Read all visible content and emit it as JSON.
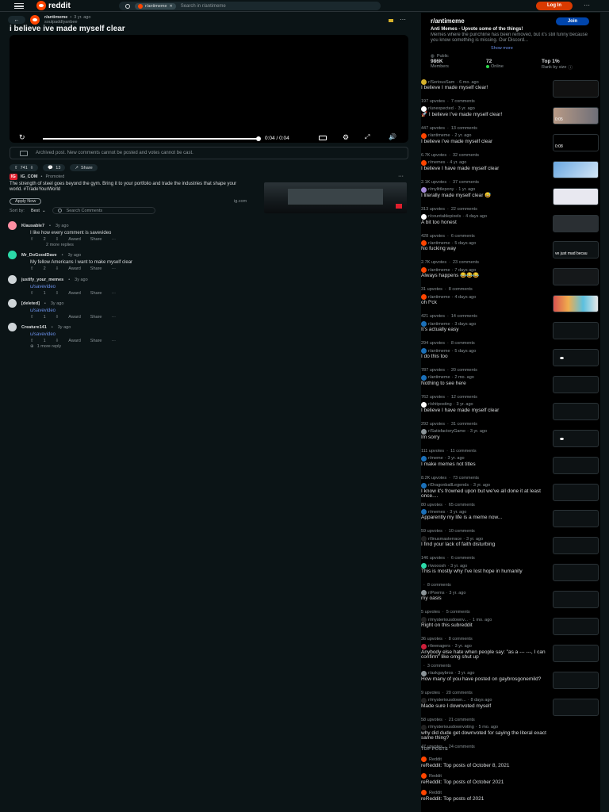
{
  "topbar": {
    "logo_text": "reddit",
    "search_chip": "r/antimeme",
    "search_placeholder": "Search in r/antimeme",
    "login_label": "Log In",
    "more_label": "···"
  },
  "post": {
    "subreddit": "r/antimeme",
    "time": "3 yr. ago",
    "author": "soulpaddlyanbee",
    "title": "i believe ive made myself clear",
    "video_time": "0:04 / 0:04",
    "progress": 1.0,
    "archived_notice": "Archived post. New comments cannot be posted and votes cannot be cast.",
    "votes": "741",
    "comments_count": "13",
    "share_label": "Share"
  },
  "ad": {
    "badge": "IG",
    "advertiser": "IG_COM",
    "promoted": "Promoted",
    "text": "The strength of steel goes beyond the gym. Bring it to your portfolio and trade the industries that shape your world. #TradeYourWorld",
    "cta": "Apply Now",
    "domain": "ig.com"
  },
  "sort": {
    "label": "Sort by:",
    "value": "Best",
    "search_placeholder": "Search Comments"
  },
  "comments": [
    {
      "author": "Klausable7",
      "time": "3y ago",
      "text": "I like how every comment is savevideo",
      "votes": "2",
      "award": "Award",
      "share": "Share",
      "extra": "2 more replies",
      "color": "#ff8fa3"
    },
    {
      "author": "Mr_DoGoodDave",
      "time": "3y ago",
      "text": "My fellow Americans I want to make myself clear",
      "votes": "2",
      "award": "Award",
      "share": "Share",
      "extra": "",
      "color": "#2bd9a8"
    },
    {
      "author": "justify_your_memes",
      "time": "3y ago",
      "text": "",
      "votes": "",
      "award": "",
      "share": "",
      "extra": "",
      "color": "#cfd5d8"
    },
    {
      "author": "u/savevideo",
      "time": "",
      "text": "",
      "votes": "1",
      "award": "Award",
      "share": "Share",
      "extra": "",
      "color": ""
    },
    {
      "author": "[deleted]",
      "time": "3y ago",
      "text": "u/savevideo",
      "votes": "1",
      "award": "Award",
      "share": "Share",
      "extra": "",
      "color": "#cfd5d8"
    },
    {
      "author": "Creature141",
      "time": "3y ago",
      "text": "u/savevideo",
      "votes": "1",
      "award": "Award",
      "share": "Share",
      "extra": "1 more reply",
      "color": "#cfd5d8"
    }
  ],
  "sidebar": {
    "name": "r/antimeme",
    "join_label": "Join",
    "desc_title": "Anti Memes - Upvote some of the things!",
    "desc": "Memes where the punchline has been removed, but it's still funny because you know something is missing. Our Discord...",
    "show_more": "Show more",
    "status": "Public",
    "members_value": "986K",
    "members_label": "Members",
    "online_value": "72",
    "online_label": "Online",
    "rank_value": "Top 1%",
    "rank_label": "Rank by size"
  },
  "related": [
    {
      "sub": "r/SeriousSam",
      "time": "6 mo. ago",
      "title": "I believe I made myself clear!",
      "upvotes": "197 upvotes",
      "comments": "7 comments",
      "icon_color": "#d6b12b",
      "thumb": "dark-figure",
      "thumb_text": ""
    },
    {
      "sub": "r/unexpected",
      "time": "3 yr. ago",
      "title": "🚀 I believe I've made myself clear!",
      "upvotes": "447 upvotes",
      "comments": "13 comments",
      "icon_color": "#ffffff",
      "thumb": "hand",
      "thumb_text": "0:05"
    },
    {
      "sub": "r/antimeme",
      "time": "2 yr. ago",
      "title": "I believe i've made myself clear",
      "upvotes": "6.7K upvotes",
      "comments": "32 comments",
      "icon_color": "#ff4500",
      "thumb": "black",
      "thumb_text": "0:08"
    },
    {
      "sub": "r/memes",
      "time": "4 yr. ago",
      "title": "I believe I have made myself clear",
      "upvotes": "2.1K upvotes",
      "comments": "37 comments",
      "icon_color": "#ff4500",
      "thumb": "blue",
      "thumb_text": ""
    },
    {
      "sub": "r/mylittlepony",
      "time": "1 yr. ago",
      "title": "I literally made myself clear 😅",
      "upvotes": "313 upvotes",
      "comments": "22 comments",
      "icon_color": "#a58ad9",
      "thumb": "white",
      "thumb_text": ""
    },
    {
      "sub": "r/countablepixels",
      "time": "4 days ago",
      "title": "A bit too honest",
      "upvotes": "428 upvotes",
      "comments": "6 comments",
      "icon_color": "#ffffff",
      "thumb": "grey",
      "thumb_text": ""
    },
    {
      "sub": "r/antimeme",
      "time": "5 days ago",
      "title": "No fucking way",
      "upvotes": "2.7K upvotes",
      "comments": "23 comments",
      "icon_color": "#ff4500",
      "thumb": "text",
      "thumb_text": "ve just mad becau"
    },
    {
      "sub": "r/antimeme",
      "time": "7 days ago",
      "title": "Always happens 😂😂😂",
      "upvotes": "31 upvotes",
      "comments": "8 comments",
      "icon_color": "#ff4500",
      "thumb": "dark",
      "thumb_text": ""
    },
    {
      "sub": "r/antimeme",
      "time": "4 days ago",
      "title": "oh f*ck",
      "upvotes": "421 upvotes",
      "comments": "14 comments",
      "icon_color": "#ff4500",
      "thumb": "colorful",
      "thumb_text": ""
    },
    {
      "sub": "r/antimeme",
      "time": "3 days ago",
      "title": "It's actually easy",
      "upvotes": "294 upvotes",
      "comments": "8 comments",
      "icon_color": "#1a6fb8",
      "thumb": "empty",
      "thumb_text": ""
    },
    {
      "sub": "r/antimeme",
      "time": "5 days ago",
      "title": "I do this too",
      "upvotes": "787 upvotes",
      "comments": "20 comments",
      "icon_color": "#1a6fb8",
      "thumb": "dot",
      "thumb_text": ""
    },
    {
      "sub": "r/antimeme",
      "time": "2 mo. ago",
      "title": "Nothing to see here",
      "upvotes": "762 upvotes",
      "comments": "12 comments",
      "icon_color": "#1a6fb8",
      "thumb": "empty",
      "thumb_text": ""
    },
    {
      "sub": "r/shitposting",
      "time": "3 yr. ago",
      "title": "I believe I have made myself clear",
      "upvotes": "292 upvotes",
      "comments": "31 comments",
      "icon_color": "#ffffff",
      "thumb": "empty",
      "thumb_text": ""
    },
    {
      "sub": "r/SatisfactoryGame",
      "time": "3 yr. ago",
      "title": "Im sorry",
      "upvotes": "111 upvotes",
      "comments": "11 comments",
      "icon_color": "#8b9498",
      "thumb": "dots",
      "thumb_text": ""
    },
    {
      "sub": "r/meme",
      "time": "3 yr. ago",
      "title": "I make memes not titles",
      "upvotes": "8.2K upvotes",
      "comments": "73 comments",
      "icon_color": "#1a6fb8",
      "thumb": "empty",
      "thumb_text": ""
    },
    {
      "sub": "r/DragonballLegends",
      "time": "3 yr. ago",
      "title": "I know it's frowned upon but we've all done it at least once....",
      "upvotes": "80 upvotes",
      "comments": "65 comments",
      "icon_color": "#1a6fb8",
      "thumb": "empty",
      "thumb_text": ""
    },
    {
      "sub": "r/memes",
      "time": "3 yr. ago",
      "title": "Apparently my life is a meme now...",
      "upvotes": "59 upvotes",
      "comments": "10 comments",
      "icon_color": "#1a6fb8",
      "thumb": "empty",
      "thumb_text": ""
    },
    {
      "sub": "r/linusmasterrace",
      "time": "3 yr. ago",
      "title": "I find your lack of faith disturbing",
      "upvotes": "146 upvotes",
      "comments": "6 comments",
      "icon_color": "#222222",
      "thumb": "empty",
      "thumb_text": ""
    },
    {
      "sub": "r/wooosh",
      "time": "3 yr. ago",
      "title": "This is mostly why I've lost hope in humanity",
      "upvotes": "",
      "comments": "8 comments",
      "icon_color": "#2bd9a8",
      "thumb": "empty",
      "thumb_text": ""
    },
    {
      "sub": "r/Poems",
      "time": "3 yr. ago",
      "title": "my oasis",
      "upvotes": "5 upvotes",
      "comments": "5 comments",
      "icon_color": "#8b9498",
      "thumb": "empty",
      "thumb_text": ""
    },
    {
      "sub": "r/mysteriousdownv...",
      "time": "1 mo. ago",
      "title": "Right on this subreddit",
      "upvotes": "36 upvotes",
      "comments": "8 comments",
      "icon_color": "#222222",
      "thumb": "empty",
      "thumb_text": ""
    },
    {
      "sub": "r/teenagers",
      "time": "3 yr. ago",
      "title": "Anybody else hate when people say: \"as a --- ---, I can confirm\" like omg shut up",
      "upvotes": "",
      "comments": "3 comments",
      "icon_color": "#cc1f3a",
      "thumb": "empty",
      "thumb_text": ""
    },
    {
      "sub": "r/askgaybros",
      "time": "3 yr. ago",
      "title": "How many of you have posted on gaybrosgonemild?",
      "upvotes": "9 upvotes",
      "comments": "20 comments",
      "icon_color": "#8b9498",
      "thumb": "empty",
      "thumb_text": ""
    },
    {
      "sub": "r/mysteriousdown...",
      "time": "8 days ago",
      "title": "Made sure I downvoted myself",
      "upvotes": "58 upvotes",
      "comments": "21 comments",
      "icon_color": "#222222",
      "thumb": "empty",
      "thumb_text": ""
    },
    {
      "sub": "r/mysteriousdownvoting",
      "time": "5 mo. ago",
      "title": "why did dude get downvoted for saying the literal exact same thing?",
      "upvotes": "47 upvotes",
      "comments": "24 comments",
      "icon_color": "#222222",
      "thumb": "none",
      "thumb_text": ""
    }
  ],
  "top_posts": {
    "header": "TOP POSTS",
    "items": [
      {
        "source": "Reddit",
        "title": "reReddit: Top posts of October 8, 2021"
      },
      {
        "source": "Reddit",
        "title": "reReddit: Top posts of October 2021"
      },
      {
        "source": "Reddit",
        "title": "reReddit: Top posts of 2021"
      }
    ]
  }
}
